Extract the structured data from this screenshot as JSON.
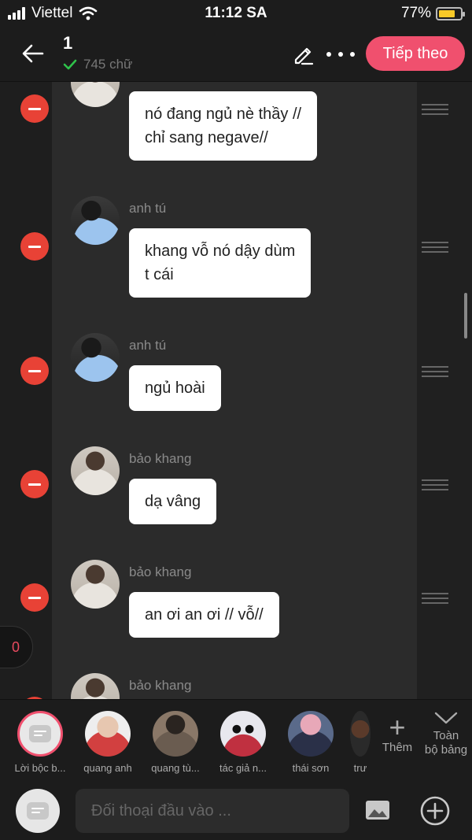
{
  "status_bar": {
    "carrier": "Viettel",
    "time": "11:12 SA",
    "battery": "77%",
    "battery_level": 0.77
  },
  "header": {
    "chapter_number": "1",
    "word_count": "745 chữ",
    "next_button": "Tiếp theo"
  },
  "messages": [
    {
      "sender": "",
      "avatar": "khang",
      "lines": [
        "nó đang ngủ nè thầy //",
        "chỉ sang negave//"
      ]
    },
    {
      "sender": "anh tú",
      "avatar": "tu",
      "lines": [
        "khang vỗ nó dậy dùm",
        "t cái"
      ]
    },
    {
      "sender": "anh tú",
      "avatar": "tu",
      "lines": [
        "ngủ hoài"
      ]
    },
    {
      "sender": "bảo khang",
      "avatar": "khang",
      "lines": [
        "dạ vâng"
      ]
    },
    {
      "sender": "bảo khang",
      "avatar": "khang",
      "lines": [
        "an ơi an ơi // vỗ//"
      ]
    },
    {
      "sender": "bảo khang",
      "avatar": "khang",
      "lines": []
    }
  ],
  "counter": "0",
  "characters": [
    {
      "name": "Lời bộc b...",
      "color": "#e8e8e8"
    },
    {
      "name": "quang anh",
      "color": "#d24040"
    },
    {
      "name": "quang tù...",
      "color": "#5a4a3a"
    },
    {
      "name": "tác giả n...",
      "color": "#c8c8d0"
    },
    {
      "name": "thái sơn",
      "color": "#3a4a6a"
    },
    {
      "name": "trư",
      "color": "#4a3a2a"
    }
  ],
  "add_character_label": "Thêm",
  "all_board_label": [
    "Toàn",
    "bộ bảng"
  ],
  "input": {
    "placeholder": "Đối thoại đầu vào ..."
  },
  "colors": {
    "accent": "#f0506e",
    "delete": "#e84236",
    "background": "#1e1e1e"
  }
}
